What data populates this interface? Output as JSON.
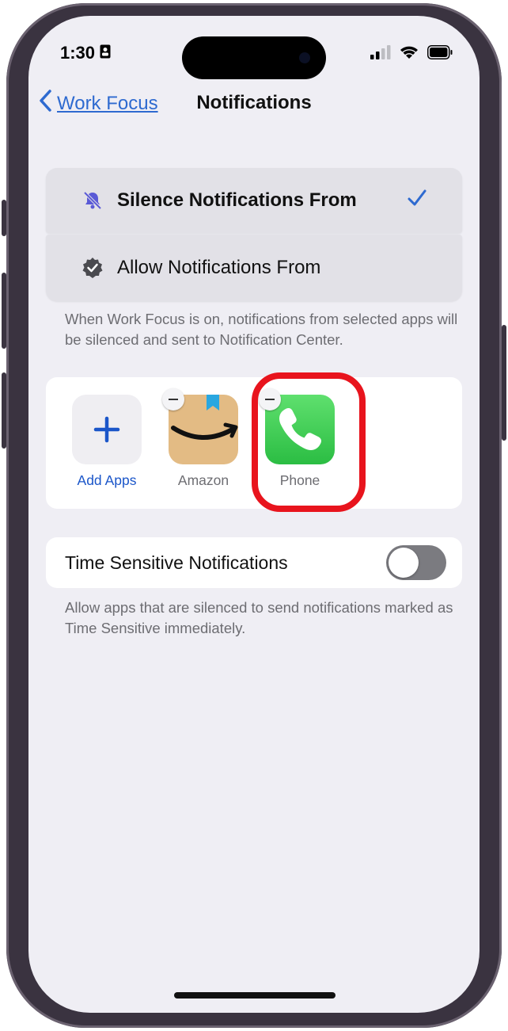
{
  "status_bar": {
    "time": "1:30",
    "icons": [
      "portrait-lock-icon",
      "signal-icon",
      "wifi-icon",
      "battery-icon"
    ]
  },
  "nav": {
    "back_label": "Work Focus",
    "title": "Notifications"
  },
  "mode_options": [
    {
      "label": "Silence Notifications From",
      "icon": "bell-slash-icon",
      "selected": true
    },
    {
      "label": "Allow Notifications From",
      "icon": "checkmark-seal-icon",
      "selected": false
    }
  ],
  "mode_footnote": "When Work Focus is on, notifications from selected apps will be silenced and sent to Notification Center.",
  "apps": {
    "add_label": "Add Apps",
    "items": [
      {
        "label": "Amazon",
        "icon": "amazon-app-icon"
      },
      {
        "label": "Phone",
        "icon": "phone-app-icon"
      }
    ]
  },
  "time_sensitive": {
    "label": "Time Sensitive Notifications",
    "enabled": false,
    "footnote": "Allow apps that are silenced to send notifications marked as Time Sensitive immediately."
  },
  "colors": {
    "accent": "#2e6ad0",
    "highlight": "#e8141d",
    "phone_green": "#34c759",
    "background": "#efeef4"
  }
}
